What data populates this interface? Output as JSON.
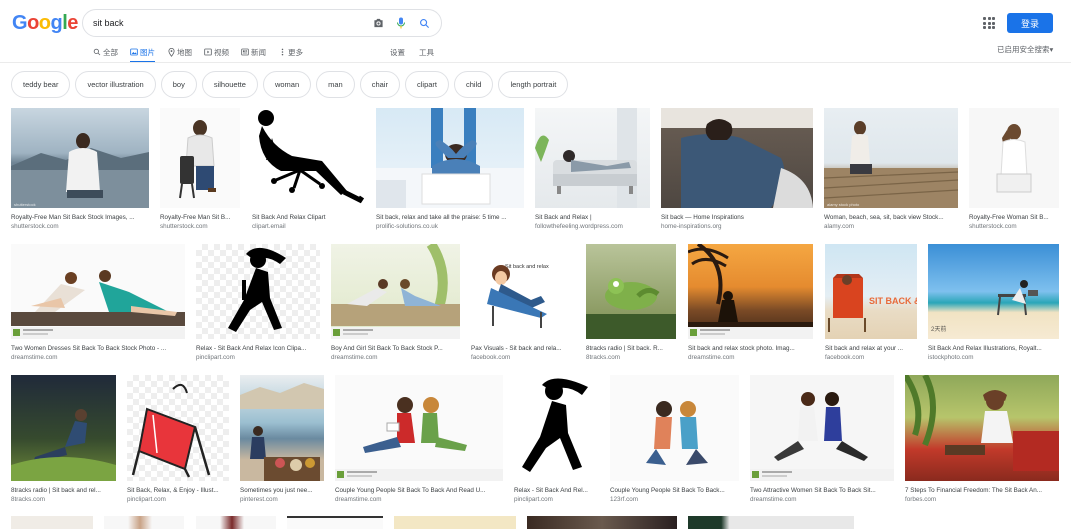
{
  "logo": {
    "letters": [
      "G",
      "o",
      "o",
      "g",
      "l",
      "e"
    ]
  },
  "search": {
    "query": "sit back"
  },
  "header": {
    "login_label": "登录"
  },
  "tabs": [
    {
      "label": "全部",
      "icon": "search-icon"
    },
    {
      "label": "图片",
      "icon": "image-icon",
      "active": true
    },
    {
      "label": "地图",
      "icon": "map-pin-icon"
    },
    {
      "label": "视频",
      "icon": "video-icon"
    },
    {
      "label": "新闻",
      "icon": "news-icon"
    },
    {
      "label": "更多",
      "icon": "more-vert-icon"
    }
  ],
  "tools": {
    "settings": "设置",
    "tools": "工具"
  },
  "safesearch": "已启用安全搜索▾",
  "chips": [
    "teddy bear",
    "vector illustration",
    "boy",
    "silhouette",
    "woman",
    "man",
    "chair",
    "clipart",
    "child",
    "length portrait"
  ],
  "results": [
    {
      "cap": "Royalty-Free Man Sit Back Stock Images, ...",
      "src": "shutterstock.com"
    },
    {
      "cap": "Royalty-Free Man Sit B...",
      "src": "shutterstock.com"
    },
    {
      "cap": "Sit Back And Relax Clipart",
      "src": "clipart.email"
    },
    {
      "cap": "Sit back, relax and take all the praise: 5 time ...",
      "src": "prolific-solutions.co.uk"
    },
    {
      "cap": "Sit Back and Relax |",
      "src": "followthefeeling.wordpress.com"
    },
    {
      "cap": "Sit back — Home Inspirations",
      "src": "home-inspirations.org"
    },
    {
      "cap": "Woman, beach, sea, sit, back view Stock...",
      "src": "alamy.com",
      "wm": "alamy stock photo"
    },
    {
      "cap": "Royalty-Free Woman Sit B...",
      "src": "shutterstock.com"
    },
    {
      "cap": "Two Women Dresses Sit Back To Back Stock Photo - ...",
      "src": "dreamstime.com"
    },
    {
      "cap": "Relax - Sit Back And Relax Icon Clipa...",
      "src": "pinclipart.com"
    },
    {
      "cap": "Boy And Girl Sit Back To Back Stock P...",
      "src": "dreamstime.com"
    },
    {
      "cap": "Pax Visuals - Sit back and rela...",
      "src": "facebook.com",
      "label": "Sit back and relax"
    },
    {
      "cap": "8tracks radio | Sit back. R...",
      "src": "8tracks.com"
    },
    {
      "cap": "Sit back and relax stock photo. Imag...",
      "src": "dreamstime.com"
    },
    {
      "cap": "Sit back and relax at your ...",
      "src": "facebook.com",
      "label": "SIT BACK & RELAX"
    },
    {
      "cap": "Sit Back And Relax Illustrations, Royalt...",
      "src": "istockphoto.com",
      "badge": "2天前"
    },
    {
      "cap": "8tracks radio | Sit back and rel...",
      "src": "8tracks.com"
    },
    {
      "cap": "Sit Back, Relax, & Enjoy - Illust...",
      "src": "pinclipart.com"
    },
    {
      "cap": "Sometimes you just nee...",
      "src": "pinterest.com"
    },
    {
      "cap": "Couple Young People Sit Back To Back And Read U...",
      "src": "dreamstime.com"
    },
    {
      "cap": "Relax - Sit Back And Rel...",
      "src": "pinclipart.com"
    },
    {
      "cap": "Couple Young People Sit Back To Back...",
      "src": "123rf.com"
    },
    {
      "cap": "Two Attractive Women Sit Back To Back Sit...",
      "src": "dreamstime.com"
    },
    {
      "cap": "7 Steps To Financial Freedom: The Sit Back An...",
      "src": "forbes.com"
    }
  ],
  "colors": {
    "accent": "#1a73e8",
    "chip_border": "#dfe1e5"
  }
}
